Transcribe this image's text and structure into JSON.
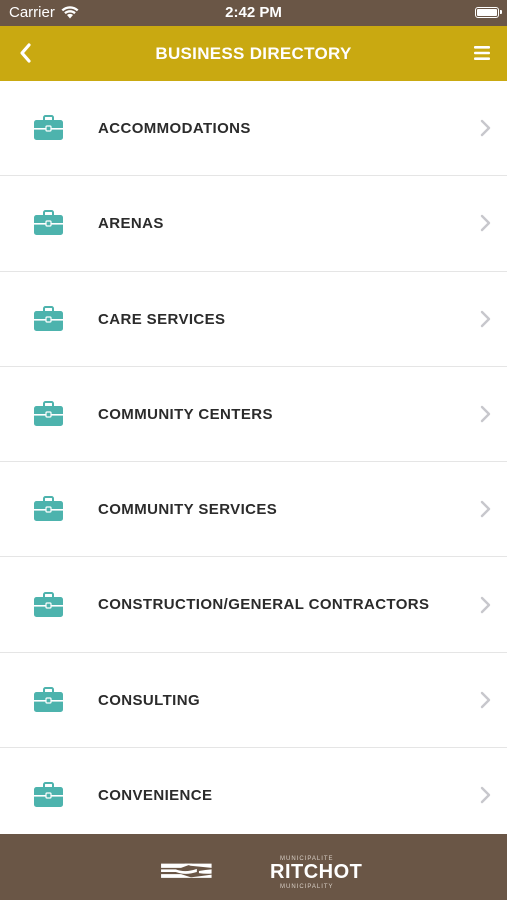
{
  "status_bar": {
    "carrier": "Carrier",
    "time": "2:42 PM"
  },
  "nav": {
    "title": "BUSINESS DIRECTORY",
    "back_icon": "chevron-left-icon",
    "menu_icon": "hamburger-menu-icon"
  },
  "categories": [
    {
      "label": "ACCOMMODATIONS"
    },
    {
      "label": "ARENAS"
    },
    {
      "label": "CARE SERVICES"
    },
    {
      "label": "COMMUNITY CENTERS"
    },
    {
      "label": "COMMUNITY SERVICES"
    },
    {
      "label": "CONSTRUCTION/GENERAL CONTRACTORS"
    },
    {
      "label": "CONSULTING"
    },
    {
      "label": "CONVENIENCE"
    }
  ],
  "item_icon": "briefcase-icon",
  "footer": {
    "logo_text": "RITCHOT",
    "logo_sub_top": "MUNICIPALITE",
    "logo_sub_bottom": "MUNICIPALITY"
  },
  "colors": {
    "status_bar": "#6a5646",
    "nav_bar": "#c9a911",
    "icon_teal": "#4db3ad",
    "footer": "#6a5646"
  }
}
